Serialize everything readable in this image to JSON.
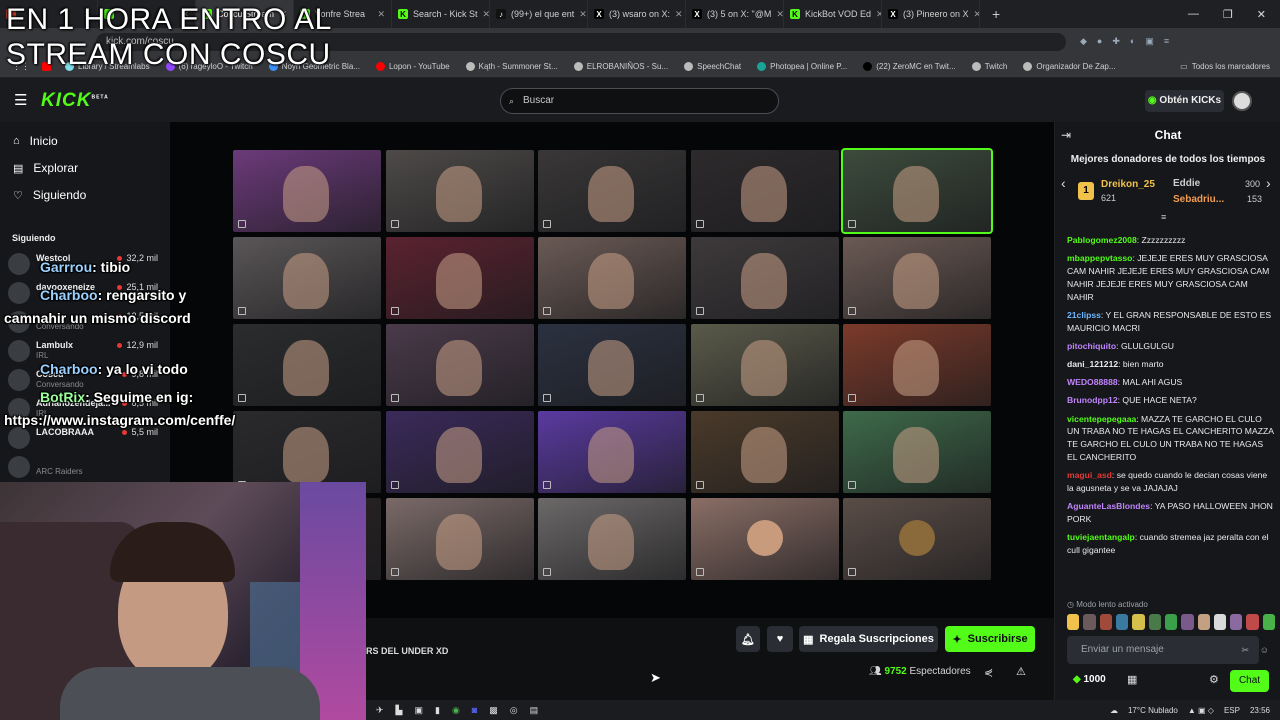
{
  "overlay_title": "EN 1 HORA ENTRO AL STREAM CON COSCU",
  "browser": {
    "tabs": [
      {
        "label": "",
        "fav": "#c0392b",
        "glyph": ""
      },
      {
        "label": "",
        "fav": "#53fc18",
        "glyph": ""
      },
      {
        "label": "Coscu Stream",
        "fav": "#53fc18",
        "glyph": "K",
        "active": true
      },
      {
        "label": "Vonfre Strea",
        "fav": "#53fc18",
        "glyph": "K"
      },
      {
        "label": "Search - Kick St",
        "fav": "#53fc18",
        "glyph": "K"
      },
      {
        "label": "(99+) el que ent",
        "fav": "#111",
        "glyph": "♪"
      },
      {
        "label": "(3) wsaro on X:",
        "fav": "#000",
        "glyph": "X"
      },
      {
        "label": "(3) 5 on X: \"@M",
        "fav": "#000",
        "glyph": "X"
      },
      {
        "label": "KickBot VOD Ed",
        "fav": "#53fc18",
        "glyph": "K"
      },
      {
        "label": "(3) Pineero on X",
        "fav": "#000",
        "glyph": "X"
      }
    ],
    "new_tab": "+",
    "url": "kick.com/coscu",
    "bookmarks": [
      {
        "label": "Library / Streamlabs",
        "color": "#80deea"
      },
      {
        "label": "(6) rageyloO - Twitch",
        "color": "#9146ff"
      },
      {
        "label": "Noyn Geometric Bla...",
        "color": "#3e8ef7"
      },
      {
        "label": "Lopon - YouTube",
        "color": "#ff0000"
      },
      {
        "label": "Kąth - Summoner St...",
        "color": "#bbbbbb"
      },
      {
        "label": "ELROBANIÑOS - Su...",
        "color": "#bbbbbb"
      },
      {
        "label": "SpeechChat",
        "color": "#bbbbbb"
      },
      {
        "label": "Photopea | Online P...",
        "color": "#18a497"
      },
      {
        "label": "(22) ZeroMC en Twit...",
        "color": "#000000"
      },
      {
        "label": "Twitch",
        "color": "#bbbbbb"
      },
      {
        "label": "Organizador De Zap...",
        "color": "#bbbbbb"
      }
    ],
    "all_bookmarks": "Todos los marcadores"
  },
  "kick": {
    "logo": "KICK",
    "logo_badge": "BETA",
    "search_placeholder": "Buscar",
    "kicks_button": "Obtén KICKs",
    "nav": [
      {
        "label": "Inicio",
        "icon": "home-icon",
        "glyph": "⌂"
      },
      {
        "label": "Explorar",
        "icon": "compass-icon",
        "glyph": "▤"
      },
      {
        "label": "Siguiendo",
        "icon": "heart-icon",
        "glyph": "♡"
      }
    ],
    "following_title": "Siguiendo",
    "following": [
      {
        "name": "Westcol",
        "category": "",
        "viewers": "32,2 mil"
      },
      {
        "name": "davooxeneize",
        "category": "",
        "viewers": "25,1 mil"
      },
      {
        "name": "",
        "category": "Conversando",
        "viewers": "12,5 mil"
      },
      {
        "name": "Lambulx",
        "category": "IRL",
        "viewers": "12,9 mil"
      },
      {
        "name": "Coscu",
        "category": "Conversando",
        "viewers": "9,8 mil"
      },
      {
        "name": "Adrianozendeja...",
        "category": "IRL",
        "viewers": "6,5 mil"
      },
      {
        "name": "LACOBRAAA",
        "category": "",
        "viewers": "5,5 mil"
      },
      {
        "name": "",
        "category": "ARC Raiders",
        "viewers": ""
      }
    ]
  },
  "chat_overlay": [
    {
      "user": "Garrrou",
      "text": ": tibio",
      "bot": false
    },
    {
      "user": "Charboo",
      "text": ": rengarsito y camnahir un mismo discord",
      "bot": false
    },
    {
      "user": "Charboo",
      "text": ": ya lo vi todo",
      "bot": false
    },
    {
      "user": "BotRix",
      "text": ": Seguime en ig: https://www.instagram.com/cenffe/",
      "bot": true
    }
  ],
  "player": {
    "stream_title": "RS DEL UNDER XD",
    "gift_button": "Regala Suscripciones",
    "subscribe_button": "Suscribirse",
    "viewers_count": "9752",
    "viewers_label": "Espectadores",
    "tile_colors": [
      "#6b3a7a",
      "#4d4a48",
      "#393738",
      "#2d2a2c",
      "#3c4b3c",
      "#5a5657",
      "#5b2230",
      "#6a5a55",
      "#3e3a3c",
      "#6b5a54",
      "#2a2c2e",
      "#4a3a4a",
      "#2b3140",
      "#5a5a4a",
      "#7b3a2a",
      "#2a2a2c",
      "#3a2a5a",
      "#5a3aa0",
      "#4a3a2a",
      "#3e6a4a",
      "#2a2426",
      "#7a6a68",
      "#6b6868",
      "#8a6e66",
      "#5a4d47"
    ]
  },
  "chat": {
    "title": "Chat",
    "donors_title": "Mejores donadores de todos los tiempos",
    "top_donor": {
      "name": "Dreikon_25",
      "amount": "621",
      "rank": "1"
    },
    "donor2": {
      "name": "Eddie",
      "amount": "300"
    },
    "donor3": {
      "name": "Sebadriu...",
      "amount": "153"
    },
    "messages": [
      {
        "user": "Pablogomez2008",
        "color": "#53fc18",
        "text": "Zzzzzzzzzz"
      },
      {
        "user": "mbappepvtasso",
        "color": "#53fc18",
        "text": "JEJEJE ERES MUY GRASCIOSA CAM NAHIR JEJEJE ERES MUY GRASCIOSA CAM NAHIR JEJEJE ERES MUY GRASCIOSA CAM NAHIR"
      },
      {
        "user": "21clipss",
        "color": "#6fb6ff",
        "text": "Y EL GRAN RESPONSABLE DE ESTO ES MAURICIO MACRI"
      },
      {
        "user": "pitochiquito",
        "color": "#c084fc",
        "text": "GLULGULGU"
      },
      {
        "user": "dani_121212",
        "color": "#eaeaea",
        "text": "bien marto"
      },
      {
        "user": "WEDO88888",
        "color": "#c084fc",
        "text": "MAL AHI AGUS"
      },
      {
        "user": "Brunodpp12",
        "color": "#c084fc",
        "text": "QUE HACE NETA?"
      },
      {
        "user": "vicentepepegaaa",
        "color": "#53fc18",
        "text": "MAZZA TE GARCHO EL CULO UN TRABA NO TE HAGAS EL CANCHERITO MAZZA TE GARCHO EL CULO UN TRABA NO TE HAGAS EL CANCHERITO"
      },
      {
        "user": "magui_asd",
        "color": "#e53935",
        "text": "se quedo cuando le decian cosas viene la agusneta y se va JAJAJAJ"
      },
      {
        "user": "AguanteLasBlondes",
        "color": "#c084fc",
        "text": "YA PASO HALLOWEEN JHON PORK"
      },
      {
        "user": "tuviejaentangalp",
        "color": "#53fc18",
        "text": "cuando stremea jaz peralta con el cull gigantee"
      }
    ],
    "slow_mode": "Modo lento activado",
    "input_placeholder": "Enviar un mensaje",
    "points": "1000",
    "send_label": "Chat"
  },
  "taskbar": {
    "weather": "17°C Nublado",
    "lang": "ESP",
    "time": "23:56"
  }
}
